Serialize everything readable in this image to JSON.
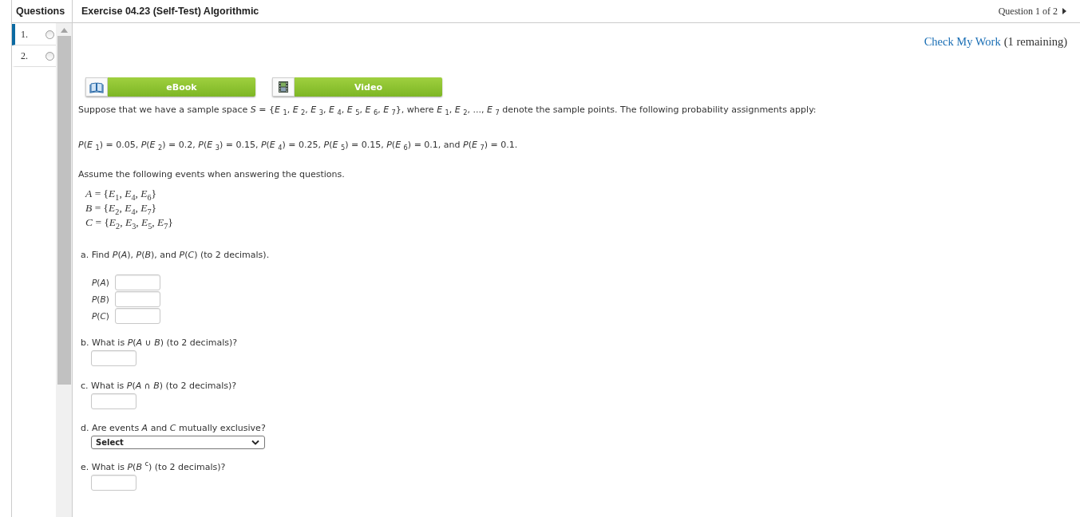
{
  "sidebar": {
    "title": "Questions",
    "items": [
      {
        "number": "1.",
        "selected": true
      },
      {
        "number": "2.",
        "selected": false
      }
    ]
  },
  "header": {
    "title": "Exercise 04.23 (Self-Test) Algorithmic",
    "position": "Question 1 of 2"
  },
  "check_work": {
    "link": "Check My Work",
    "note": "(1 remaining)"
  },
  "resources": [
    {
      "kind": "ebook",
      "label": "eBook"
    },
    {
      "kind": "video",
      "label": "Video"
    }
  ],
  "problem": {
    "intro": "Suppose that we have a sample space *S* = {*E* $_{1}$, *E* $_{2}$, *E* $_{3}$, *E* $_{4}$, *E* $_{5}$, *E* $_{6}$, *E* $_{7}$}, where *E* $_{1}$, *E* $_{2}$, ..., *E* $_{7}$ denote the sample points. The following probability assignments apply:",
    "probabilities": "*P*(*E* $_{1}$) = 0.05, *P*(*E* $_{2}$) = 0.2, *P*(*E* $_{3}$) = 0.15, *P*(*E* $_{4}$) = 0.25, *P*(*E* $_{5}$) = 0.15, *P*(*E* $_{6}$) = 0.1, and *P*(*E* $_{7}$) = 0.1.",
    "assume": "Assume the following events when answering the questions.",
    "events": [
      "*A* = {*E*$_{1}$, *E*$_{4}$, *E*$_{6}$}",
      "*B* = {*E*$_{2}$, *E*$_{4}$, *E*$_{7}$}",
      "*C* = {*E*$_{2}$, *E*$_{3}$, *E*$_{5}$, *E*$_{7}$}"
    ]
  },
  "parts": [
    {
      "kind": "fields",
      "prompt": "a. Find *P*(*A*), *P*(*B*), and *P*(*C*) (to 2 decimals).",
      "fields": [
        {
          "label": "*P*(*A*)"
        },
        {
          "label": "*P*(*B*)"
        },
        {
          "label": "*P*(*C*)"
        }
      ]
    },
    {
      "kind": "input",
      "prompt": "b. What is *P*(*A* ∪ *B*) (to 2 decimals)?"
    },
    {
      "kind": "input",
      "prompt": "c. What is *P*(*A* ∩ *B*) (to 2 decimals)?"
    },
    {
      "kind": "select",
      "prompt": "d. Are events *A* and *C* mutually exclusive?",
      "value": "Select"
    },
    {
      "kind": "input",
      "prompt": "e. What is *P*(*B* $^{c}$) (to 2 decimals)?"
    }
  ]
}
